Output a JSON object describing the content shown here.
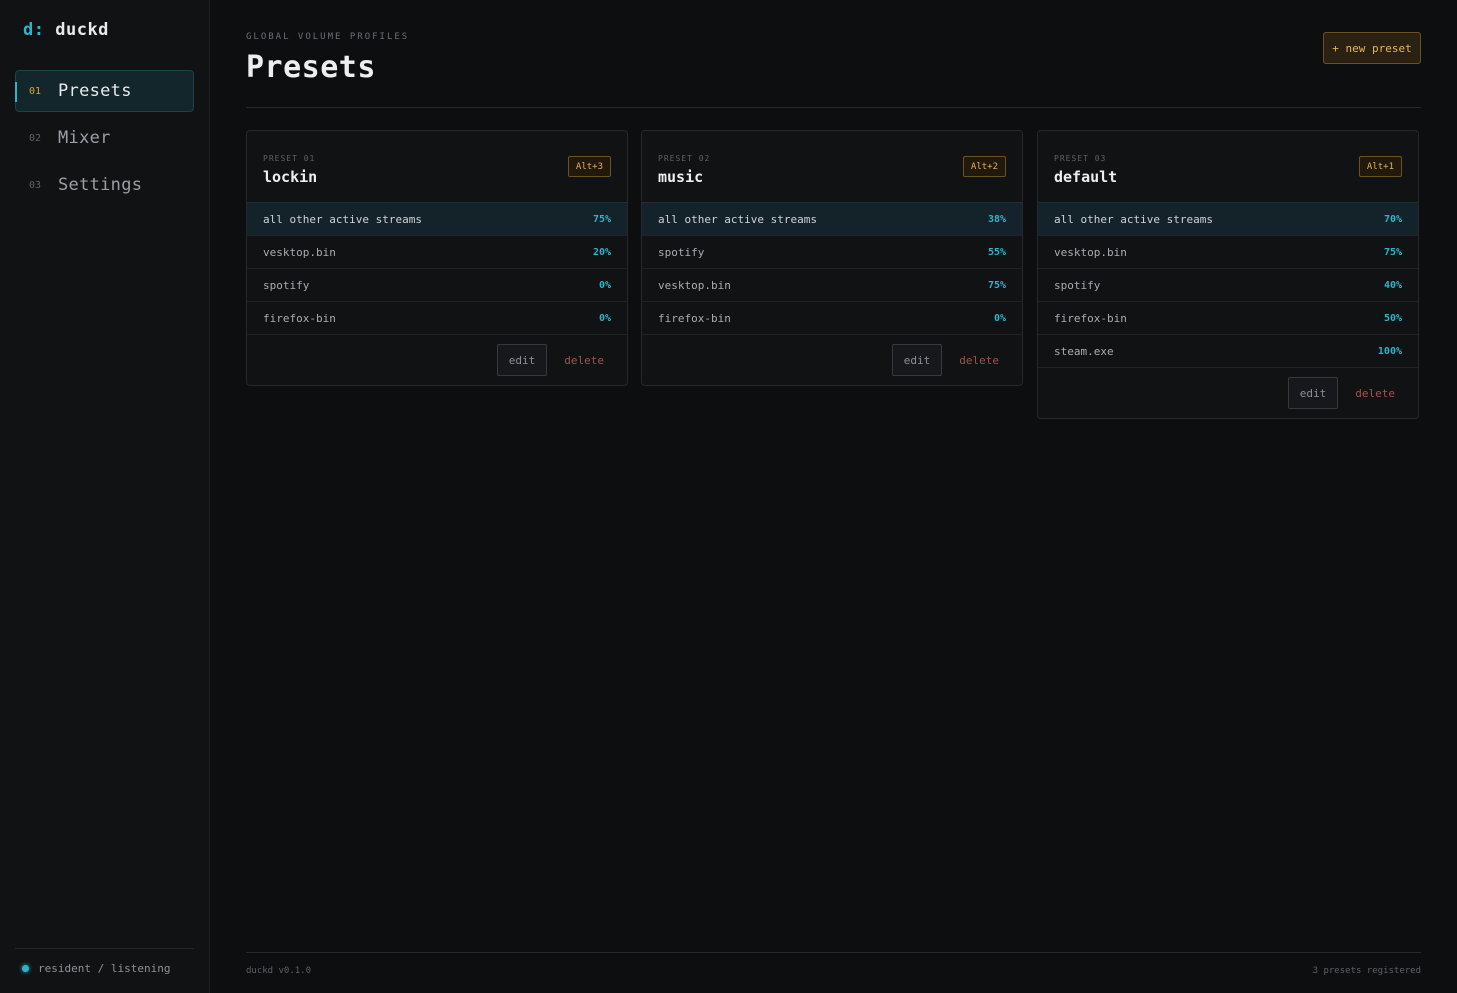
{
  "brand": {
    "mark": "d:",
    "name": "duckd"
  },
  "nav": [
    {
      "num": "01",
      "label": "Presets",
      "active": true
    },
    {
      "num": "02",
      "label": "Mixer",
      "active": false
    },
    {
      "num": "03",
      "label": "Settings",
      "active": false
    }
  ],
  "status": {
    "text": "resident / listening",
    "color": "#2bb5c9"
  },
  "header": {
    "eyebrow": "GLOBAL VOLUME PROFILES",
    "title": "Presets",
    "new_button": "+ new preset"
  },
  "presets": [
    {
      "num": "PRESET 01",
      "name": "lockin",
      "hotkey": "Alt+3",
      "rows": [
        {
          "app": "all other active streams",
          "vol": "75%"
        },
        {
          "app": "vesktop.bin",
          "vol": "20%"
        },
        {
          "app": "spotify",
          "vol": "0%"
        },
        {
          "app": "firefox-bin",
          "vol": "0%"
        }
      ],
      "edit": "edit",
      "delete": "delete"
    },
    {
      "num": "PRESET 02",
      "name": "music",
      "hotkey": "Alt+2",
      "rows": [
        {
          "app": "all other active streams",
          "vol": "38%"
        },
        {
          "app": "spotify",
          "vol": "55%"
        },
        {
          "app": "vesktop.bin",
          "vol": "75%"
        },
        {
          "app": "firefox-bin",
          "vol": "0%"
        }
      ],
      "edit": "edit",
      "delete": "delete"
    },
    {
      "num": "PRESET 03",
      "name": "default",
      "hotkey": "Alt+1",
      "rows": [
        {
          "app": "all other active streams",
          "vol": "70%"
        },
        {
          "app": "vesktop.bin",
          "vol": "75%"
        },
        {
          "app": "spotify",
          "vol": "40%"
        },
        {
          "app": "firefox-bin",
          "vol": "50%"
        },
        {
          "app": "steam.exe",
          "vol": "100%"
        }
      ],
      "edit": "edit",
      "delete": "delete"
    }
  ],
  "footer": {
    "version": "duckd v0.1.0",
    "count": "3 presets registered"
  },
  "colors": {
    "accent": "#2bb5c9",
    "hotkey": "#e0b154",
    "danger": "#a3524c"
  }
}
